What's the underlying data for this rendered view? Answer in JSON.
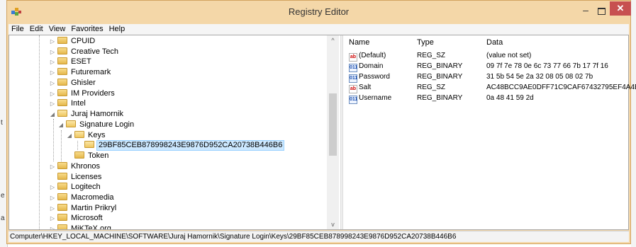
{
  "window": {
    "title": "Registry Editor",
    "minimize_glyph": "–",
    "close_glyph": "✕"
  },
  "menu": [
    "File",
    "Edit",
    "View",
    "Favorites",
    "Help"
  ],
  "tree": {
    "nodes": [
      {
        "label": "CPUID"
      },
      {
        "label": "Creative Tech"
      },
      {
        "label": "ESET"
      },
      {
        "label": "Futuremark"
      },
      {
        "label": "Ghisler"
      },
      {
        "label": "IM Providers"
      },
      {
        "label": "Intel"
      },
      {
        "label": "Juraj Hamornik"
      },
      {
        "label": "Signature Login"
      },
      {
        "label": "Keys"
      },
      {
        "label": "29BF85CEB878998243E9876D952CA20738B446B6"
      },
      {
        "label": "Token"
      },
      {
        "label": "Khronos"
      },
      {
        "label": "Licenses"
      },
      {
        "label": "Logitech"
      },
      {
        "label": "Macromedia"
      },
      {
        "label": "Martin Prikryl"
      },
      {
        "label": "Microsoft"
      },
      {
        "label": "MiKTeX.org"
      }
    ],
    "scroll_up": "^",
    "scroll_down": "v"
  },
  "values": {
    "headers": {
      "name": "Name",
      "type": "Type",
      "data": "Data"
    },
    "rows": [
      {
        "icon": "ab",
        "name": "(Default)",
        "type": "REG_SZ",
        "data": "(value not set)"
      },
      {
        "icon": "binary",
        "name": "Domain",
        "type": "REG_BINARY",
        "data": "09 7f 7e 78 0e 6c 73 77 66 7b 17 7f 16"
      },
      {
        "icon": "binary",
        "name": "Password",
        "type": "REG_BINARY",
        "data": "31 5b 54 5e 2a 32 08 05 08 02 7b"
      },
      {
        "icon": "ab",
        "name": "Salt",
        "type": "REG_SZ",
        "data": "AC48BCC9AE0DFF71C9CAF67432795EF4A4B61A08"
      },
      {
        "icon": "binary",
        "name": "Username",
        "type": "REG_BINARY",
        "data": "0a 48 41 59 2d"
      }
    ],
    "icon_text": {
      "ab": "ab",
      "binary": "011"
    }
  },
  "statusbar": "Computer\\HKEY_LOCAL_MACHINE\\SOFTWARE\\Juraj Hamornik\\Signature Login\\Keys\\29BF85CEB878998243E9876D952CA20738B446B6",
  "background_fragments": [
    "t",
    "e",
    "a"
  ],
  "colors": {
    "title_frame": "#f4d7a8",
    "close_button": "#c75050",
    "selection": "#cce8ff"
  }
}
